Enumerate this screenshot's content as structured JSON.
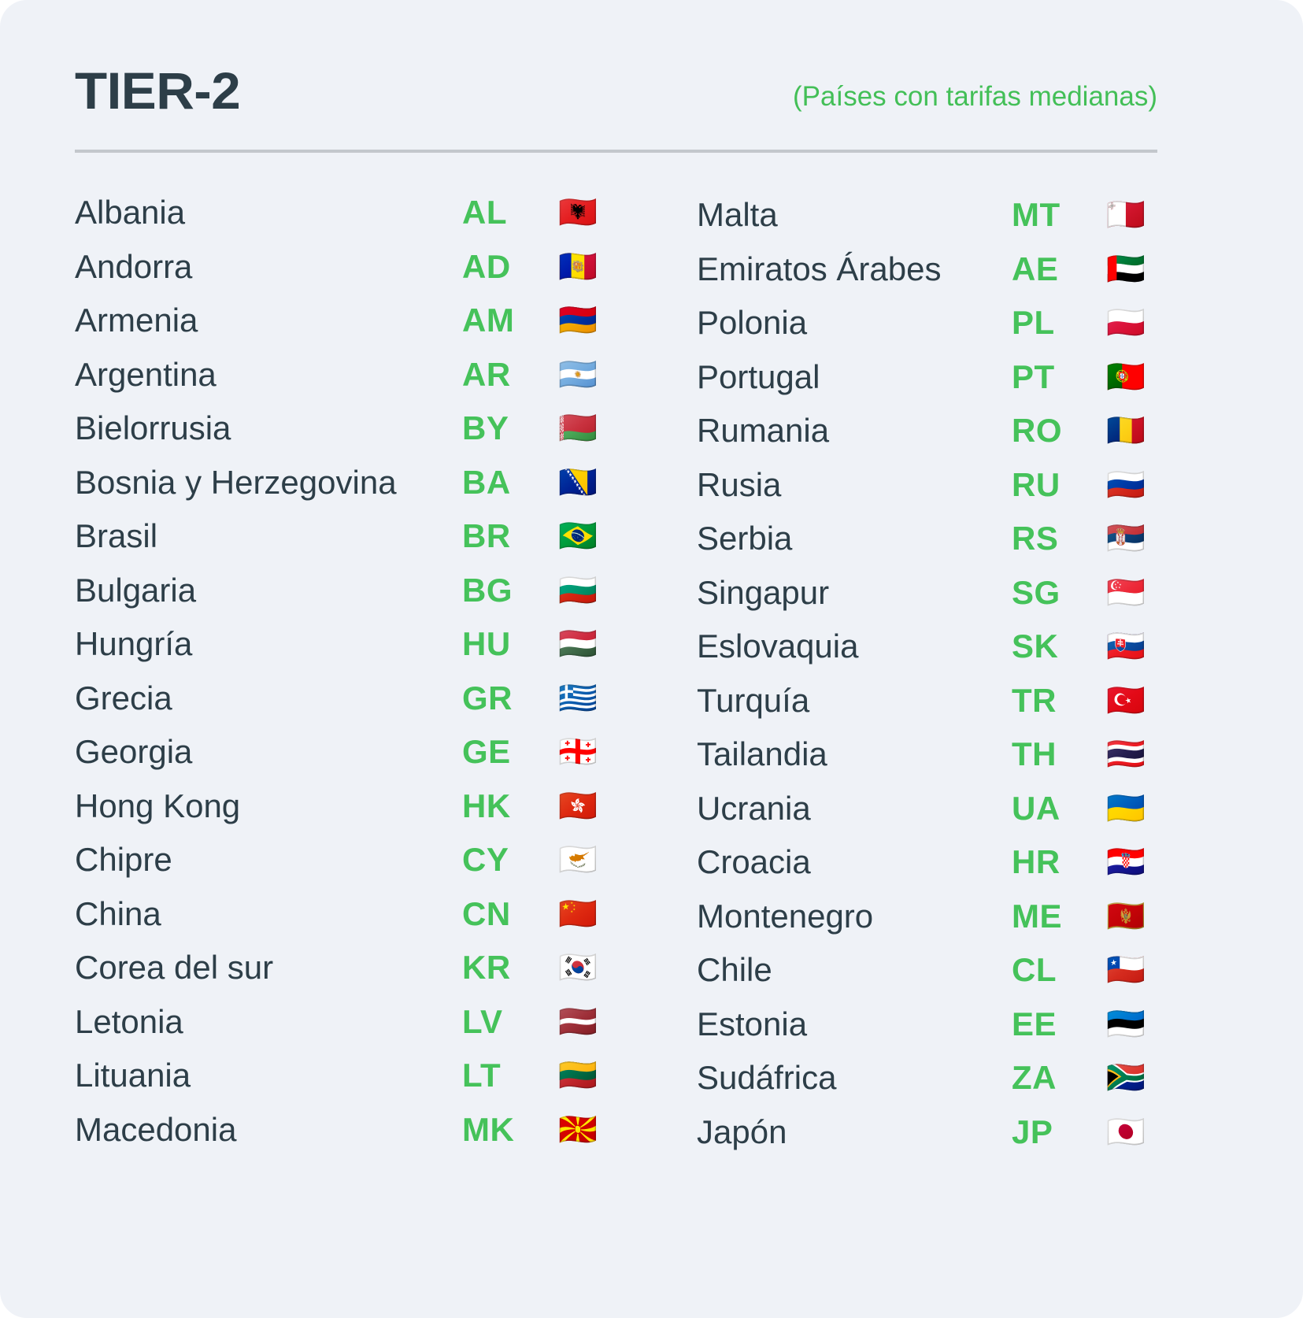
{
  "header": {
    "title": "TIER-2",
    "subtitle": "(Países con tarifas medianas)"
  },
  "colors": {
    "background": "#eff2f7",
    "text": "#2d3e48",
    "accent_green": "#45c25a",
    "divider": "#c3c7cc"
  },
  "left_column": [
    {
      "name": "Albania",
      "code": "AL",
      "flag": "🇦🇱"
    },
    {
      "name": "Andorra",
      "code": "AD",
      "flag": "🇦🇩"
    },
    {
      "name": "Armenia",
      "code": "AM",
      "flag": "🇦🇲"
    },
    {
      "name": "Argentina",
      "code": "AR",
      "flag": "🇦🇷"
    },
    {
      "name": "Bielorrusia",
      "code": "BY",
      "flag": "🇧🇾"
    },
    {
      "name": "Bosnia y Herzegovina",
      "code": "BA",
      "flag": "🇧🇦"
    },
    {
      "name": "Brasil",
      "code": "BR",
      "flag": "🇧🇷"
    },
    {
      "name": "Bulgaria",
      "code": "BG",
      "flag": "🇧🇬"
    },
    {
      "name": "Hungría",
      "code": "HU",
      "flag": "🇭🇺"
    },
    {
      "name": "Grecia",
      "code": "GR",
      "flag": "🇬🇷"
    },
    {
      "name": "Georgia",
      "code": "GE",
      "flag": "🇬🇪"
    },
    {
      "name": "Hong Kong",
      "code": "HK",
      "flag": "🇭🇰"
    },
    {
      "name": "Chipre",
      "code": "CY",
      "flag": "🇨🇾"
    },
    {
      "name": "China",
      "code": "CN",
      "flag": "🇨🇳"
    },
    {
      "name": "Corea del sur",
      "code": "KR",
      "flag": "🇰🇷"
    },
    {
      "name": "Letonia",
      "code": "LV",
      "flag": "🇱🇻"
    },
    {
      "name": "Lituania",
      "code": "LT",
      "flag": "🇱🇹"
    },
    {
      "name": "Macedonia",
      "code": "MK",
      "flag": "🇲🇰"
    }
  ],
  "right_column": [
    {
      "name": "Malta",
      "code": "MT",
      "flag": "🇲🇹"
    },
    {
      "name": "Emiratos Árabes",
      "code": "AE",
      "flag": "🇦🇪"
    },
    {
      "name": "Polonia",
      "code": "PL",
      "flag": "🇵🇱"
    },
    {
      "name": "Portugal",
      "code": "PT",
      "flag": "🇵🇹"
    },
    {
      "name": "Rumania",
      "code": "RO",
      "flag": "🇷🇴"
    },
    {
      "name": "Rusia",
      "code": "RU",
      "flag": "🇷🇺"
    },
    {
      "name": "Serbia",
      "code": "RS",
      "flag": "🇷🇸"
    },
    {
      "name": "Singapur",
      "code": "SG",
      "flag": "🇸🇬"
    },
    {
      "name": "Eslovaquia",
      "code": "SK",
      "flag": "🇸🇰"
    },
    {
      "name": "Turquía",
      "code": "TR",
      "flag": "🇹🇷"
    },
    {
      "name": "Tailandia",
      "code": "TH",
      "flag": "🇹🇭"
    },
    {
      "name": "Ucrania",
      "code": "UA",
      "flag": "🇺🇦"
    },
    {
      "name": "Croacia",
      "code": "HR",
      "flag": "🇭🇷"
    },
    {
      "name": "Montenegro",
      "code": "ME",
      "flag": "🇲🇪"
    },
    {
      "name": "Chile",
      "code": "CL",
      "flag": "🇨🇱"
    },
    {
      "name": "Estonia",
      "code": "EE",
      "flag": "🇪🇪"
    },
    {
      "name": "Sudáfrica",
      "code": "ZA",
      "flag": "🇿🇦"
    },
    {
      "name": "Japón",
      "code": "JP",
      "flag": "🇯🇵"
    }
  ]
}
